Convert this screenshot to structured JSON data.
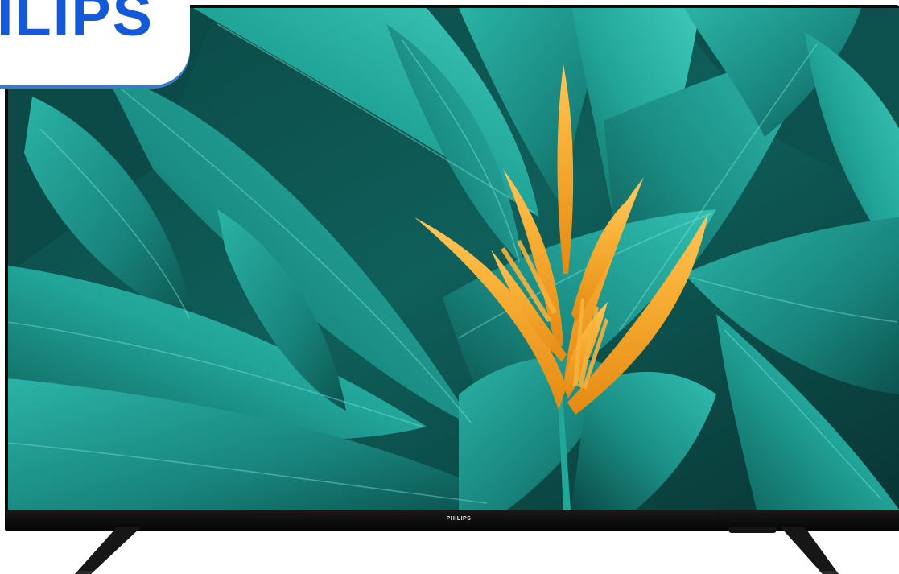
{
  "image": {
    "title": "",
    "subject": "tv-product-photo"
  },
  "brand": {
    "badge_text": "ILIPS",
    "badge_color": "#1459d6",
    "bezel_logo": "PHILIPS"
  },
  "screen": {
    "wallpaper": "tropical-leaves-bird-of-paradise",
    "leaf_color": "#1f9c92",
    "flower_color": "#f3a531"
  },
  "colors": {
    "frame": "#0b0b0b",
    "background": "#ffffff"
  }
}
